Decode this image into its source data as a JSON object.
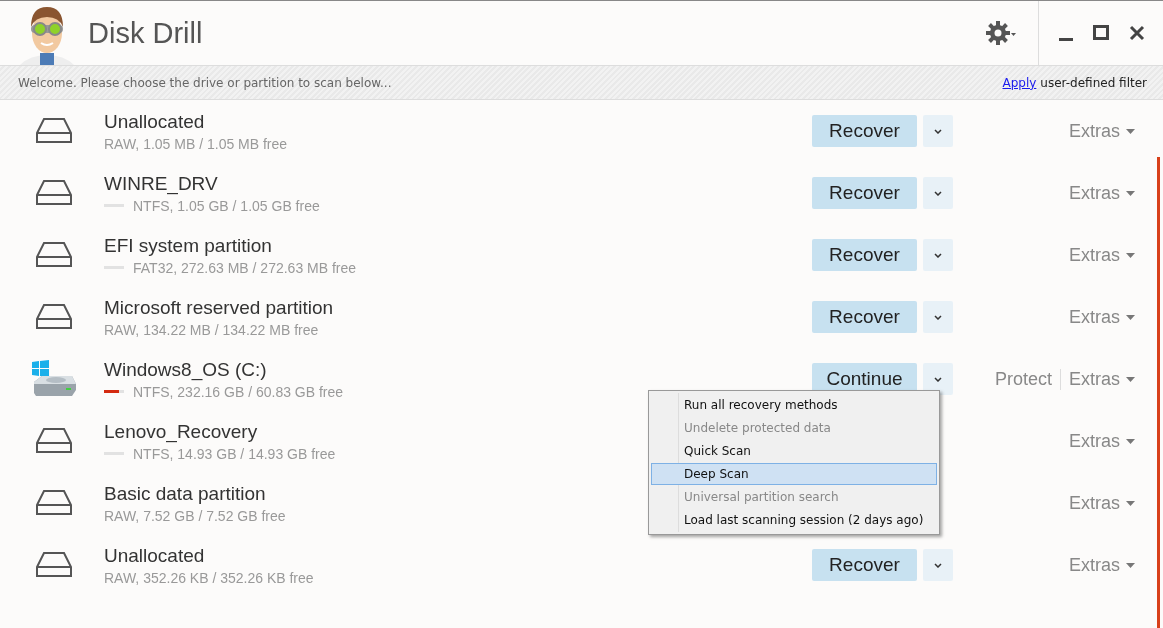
{
  "window": {
    "title": "Disk Drill"
  },
  "banner": {
    "message": "Welcome. Please choose the drive or partition to scan below...",
    "filter_link": "Apply",
    "filter_text": "user-defined filter"
  },
  "drives": [
    {
      "name": "Unallocated",
      "details": "RAW, 1.05 MB / 1.05 MB free",
      "kind": "disk",
      "action": "Recover",
      "extras": "Extras"
    },
    {
      "name": "WINRE_DRV",
      "details": "NTFS, 1.05 GB / 1.05 GB free",
      "kind": "disk",
      "level": 0,
      "action": "Recover",
      "extras": "Extras"
    },
    {
      "name": "EFI system partition",
      "details": "FAT32, 272.63 MB / 272.63 MB free",
      "kind": "disk",
      "level": 0,
      "action": "Recover",
      "extras": "Extras"
    },
    {
      "name": "Microsoft reserved partition",
      "details": "RAW, 134.22 MB / 134.22 MB free",
      "kind": "disk",
      "action": "Recover",
      "extras": "Extras"
    },
    {
      "name": "Windows8_OS (C:)",
      "details": "NTFS, 232.16 GB / 60.83 GB free",
      "kind": "system",
      "level": 0.74,
      "action": "Continue",
      "protect": "Protect",
      "extras": "Extras"
    },
    {
      "name": "Lenovo_Recovery",
      "details": "NTFS, 14.93 GB / 14.93 GB free",
      "kind": "disk",
      "level": 0,
      "extras": "Extras"
    },
    {
      "name": "Basic data partition",
      "details": "RAW, 7.52 GB / 7.52 GB free",
      "kind": "disk",
      "extras": "Extras"
    },
    {
      "name": "Unallocated",
      "details": "RAW, 352.26 KB / 352.26 KB free",
      "kind": "disk",
      "action": "Recover",
      "extras": "Extras"
    }
  ],
  "menu": {
    "items": [
      {
        "label": "Run all recovery methods",
        "disabled": false,
        "selected": false
      },
      {
        "label": "Undelete protected data",
        "disabled": true,
        "selected": false
      },
      {
        "label": "Quick Scan",
        "disabled": false,
        "selected": false
      },
      {
        "label": "Deep Scan",
        "disabled": false,
        "selected": true
      },
      {
        "label": "Universal partition search",
        "disabled": true,
        "selected": false
      },
      {
        "label": "Load last scanning session (2 days ago)",
        "disabled": false,
        "selected": false
      }
    ]
  }
}
